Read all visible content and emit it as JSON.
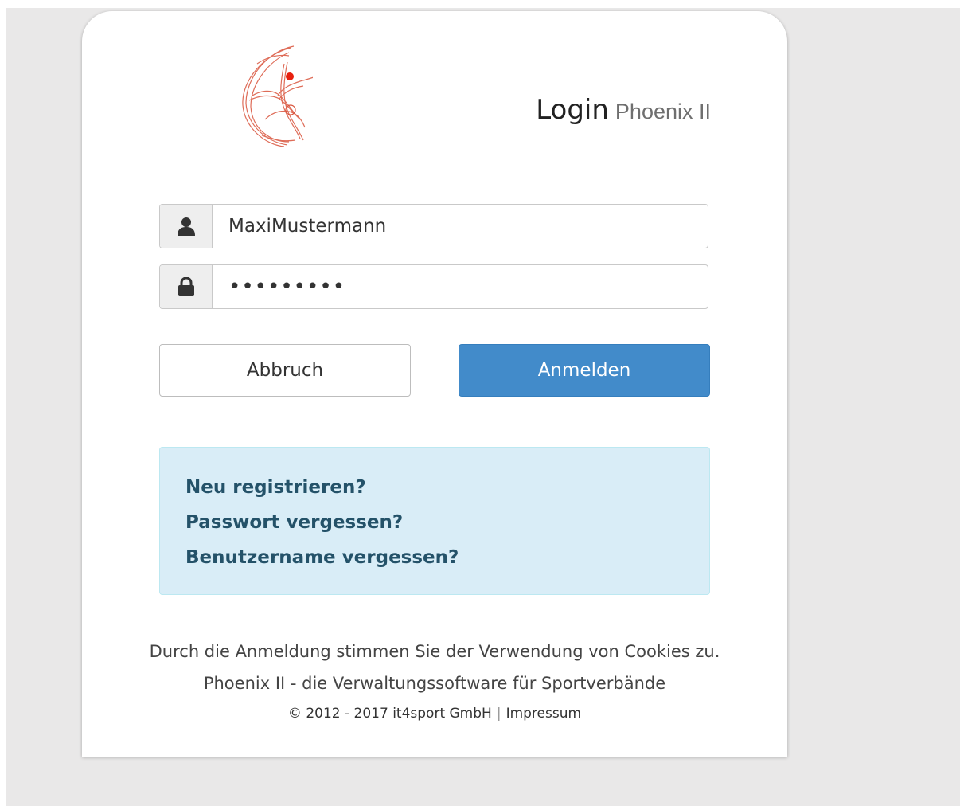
{
  "header": {
    "title": "Login",
    "product": "Phoenix II"
  },
  "form": {
    "username_value": "MaxiMustermann",
    "password_value": "•••••••••",
    "username_icon": "user-icon",
    "password_icon": "lock-icon"
  },
  "buttons": {
    "cancel_label": "Abbruch",
    "login_label": "Anmelden"
  },
  "links": {
    "register": "Neu registrieren?",
    "forgot_password": "Passwort vergessen?",
    "forgot_username": "Benutzername vergessen?"
  },
  "footer": {
    "cookie_notice": "Durch die Anmeldung stimmen Sie der Verwendung von Cookies zu.",
    "tagline": "Phoenix II - die Verwaltungssoftware für Sportverbände",
    "copyright": "© 2012 - 2017 it4sport GmbH",
    "separator": "|",
    "impressum": "Impressum"
  },
  "colors": {
    "primary": "#428bca",
    "info_bg": "#d9edf7",
    "info_text": "#245269",
    "logo": "#d9533b"
  }
}
